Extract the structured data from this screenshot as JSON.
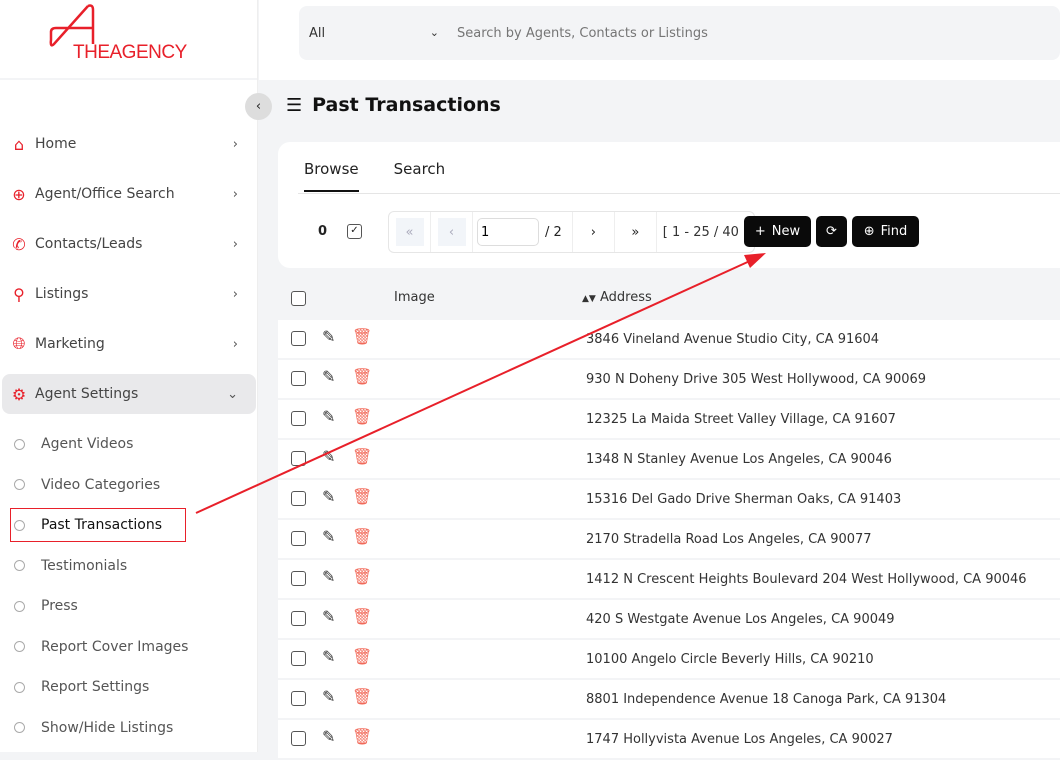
{
  "brand": {
    "logo_text": "THEAGENCY",
    "color": "#e8202a"
  },
  "search": {
    "scope": "All",
    "placeholder": "Search by Agents, Contacts or Listings"
  },
  "sidebar": {
    "items": [
      {
        "label": "Home",
        "icon": "home-icon"
      },
      {
        "label": "Agent/Office Search",
        "icon": "search-plus-icon"
      },
      {
        "label": "Contacts/Leads",
        "icon": "phone-icon"
      },
      {
        "label": "Listings",
        "icon": "search-icon"
      },
      {
        "label": "Marketing",
        "icon": "globe-icon"
      },
      {
        "label": "Agent Settings",
        "icon": "gear-icon"
      }
    ],
    "subitems": [
      "Agent Videos",
      "Video Categories",
      "Past Transactions",
      "Testimonials",
      "Press",
      "Report Cover Images",
      "Report Settings",
      "Show/Hide Listings"
    ]
  },
  "page": {
    "title": "Past Transactions"
  },
  "tabs": [
    "Browse",
    "Search"
  ],
  "toolbar": {
    "selected_count": "0",
    "page": "1",
    "total_pages": "/ 2",
    "range": "[ 1 - 25 / 40 ]",
    "new_label": "New",
    "find_label": "Find"
  },
  "table": {
    "headers": {
      "image": "Image",
      "address": "Address"
    },
    "rows": [
      "3846 Vineland Avenue Studio City, CA 91604",
      "930 N Doheny Drive 305 West Hollywood, CA 90069",
      "12325 La Maida Street Valley Village, CA 91607",
      "1348 N Stanley Avenue Los Angeles, CA 90046",
      "15316 Del Gado Drive Sherman Oaks, CA 91403",
      "2170 Stradella Road Los Angeles, CA 90077",
      "1412 N Crescent Heights Boulevard 204 West Hollywood, CA 90046",
      "420 S Westgate Avenue Los Angeles, CA 90049",
      "10100 Angelo Circle Beverly Hills, CA 90210",
      "8801 Independence Avenue 18 Canoga Park, CA 91304",
      "1747 Hollyvista Avenue Los Angeles, CA 90027"
    ]
  }
}
